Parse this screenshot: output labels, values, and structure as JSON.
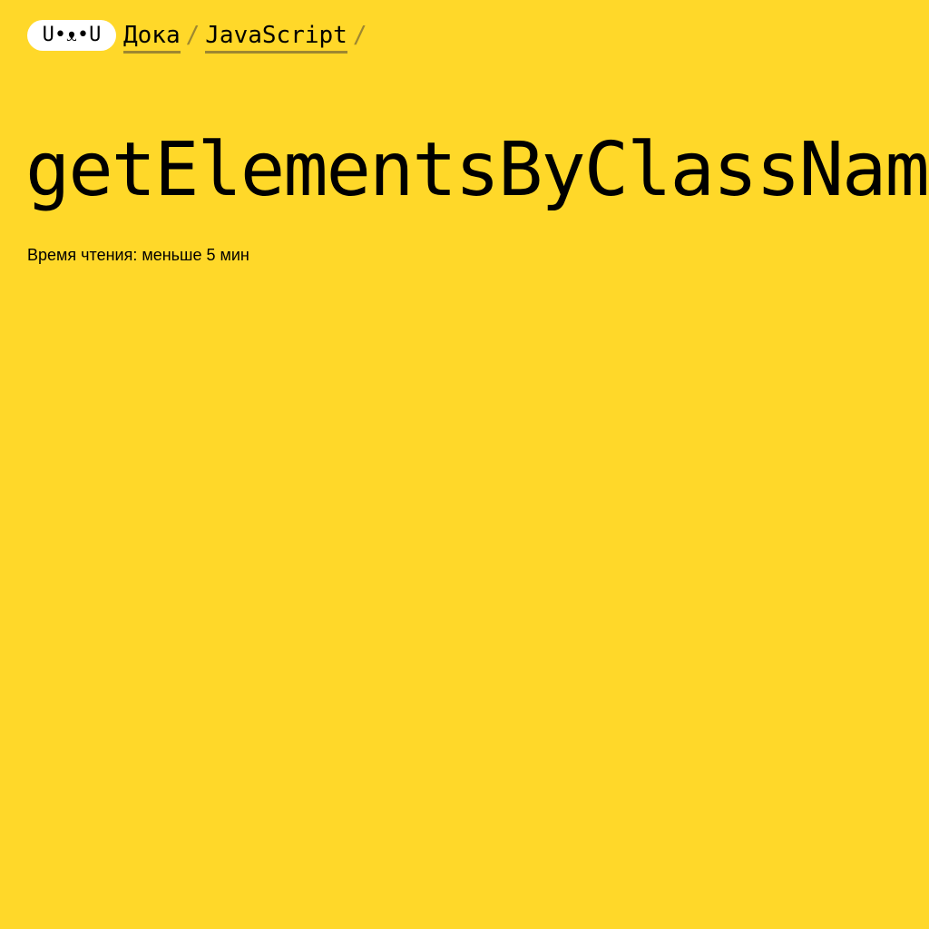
{
  "header": {
    "logo_text": "U•ᴥ•U",
    "breadcrumbs": [
      {
        "label": "Дока"
      },
      {
        "label": "JavaScript"
      }
    ],
    "separator": "/"
  },
  "article": {
    "title": "getElementsByClassName",
    "reading_time": "Время чтения: меньше 5 мин"
  },
  "colors": {
    "background": "#ffd829",
    "logo_background": "#ffffff",
    "link_underline": "#9e8730"
  }
}
